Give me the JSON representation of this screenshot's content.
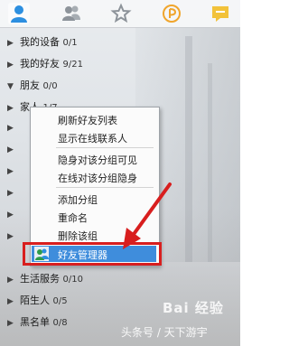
{
  "tabs": [
    {
      "id": "contacts",
      "icon": "contact-icon",
      "active": true
    },
    {
      "id": "groups",
      "icon": "group-icon",
      "active": false
    },
    {
      "id": "favorites",
      "icon": "star-icon",
      "active": false
    },
    {
      "id": "qzone",
      "icon": "qzone-icon",
      "active": false
    },
    {
      "id": "messages",
      "icon": "message-icon",
      "active": false
    }
  ],
  "groups": [
    {
      "label": "我的设备",
      "count": "0/1"
    },
    {
      "label": "我的好友",
      "count": "9/21"
    },
    {
      "label": "朋友",
      "count": "0/0"
    },
    {
      "label": "家人",
      "count": "1/7"
    },
    {
      "label": "",
      "count": ""
    },
    {
      "label": "",
      "count": ""
    },
    {
      "label": "",
      "count": ""
    },
    {
      "label": "",
      "count": ""
    },
    {
      "label": "",
      "count": ""
    },
    {
      "label": "",
      "count": ""
    },
    {
      "label": "生活服务",
      "count": "0/10"
    },
    {
      "label": "陌生人",
      "count": "0/5"
    },
    {
      "label": "黑名单",
      "count": "0/8"
    }
  ],
  "menu": {
    "items": [
      "刷新好友列表",
      "显示在线联系人",
      "隐身对该分组可见",
      "在线对该分组隐身",
      "添加分组",
      "重命名",
      "删除该组"
    ],
    "highlighted": "好友管理器"
  },
  "watermark": "Bai 经验",
  "caption": "头条号 / 天下游宇",
  "colors": {
    "accent": "#3f8ddc",
    "annotation": "#d81e1e"
  }
}
